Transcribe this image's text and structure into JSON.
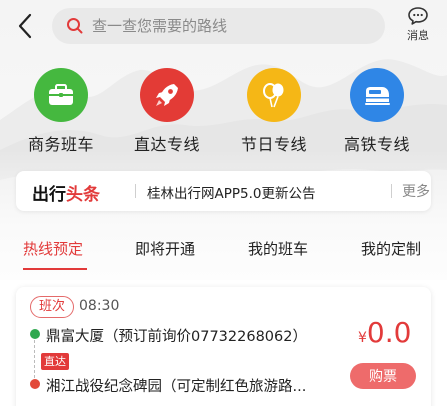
{
  "header": {
    "search_placeholder": "查一查您需要的路线",
    "message_label": "消息"
  },
  "categories": [
    {
      "label": "商务班车",
      "icon": "briefcase-icon",
      "color": "#45b83f"
    },
    {
      "label": "直达专线",
      "icon": "rocket-icon",
      "color": "#e33b36"
    },
    {
      "label": "节日专线",
      "icon": "balloon-icon",
      "color": "#f5b716"
    },
    {
      "label": "高铁专线",
      "icon": "train-icon",
      "color": "#2f86e6"
    }
  ],
  "news": {
    "logo_prefix": "出行",
    "logo_suffix": "头条",
    "text": "桂林出行网APP5.0更新公告",
    "more_label": "更多"
  },
  "tabs": [
    {
      "label": "热线预定",
      "active": true
    },
    {
      "label": "即将开通",
      "active": false
    },
    {
      "label": "我的班车",
      "active": false
    },
    {
      "label": "我的定制",
      "active": false
    }
  ],
  "route": {
    "badge": "班次",
    "time": "08:30",
    "start": "鼎富大厦（预订前询价07732268062）",
    "tag": "直达",
    "end": "湘江战役纪念碑园（可定制红色旅游路...",
    "price_symbol": "¥",
    "price": "0.0",
    "buy_label": "购票"
  },
  "colors": {
    "accent": "#e23a3a",
    "buy_button": "#ee6b6b"
  }
}
